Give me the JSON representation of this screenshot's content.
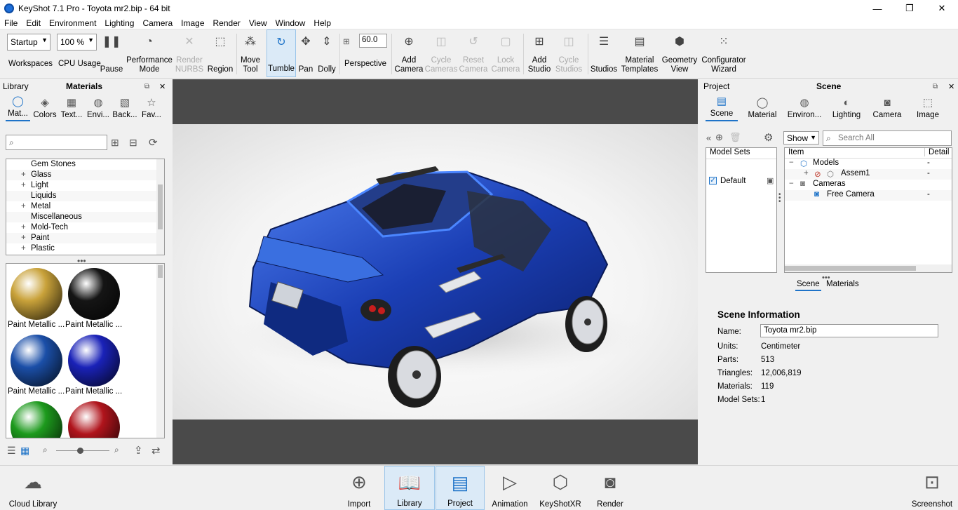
{
  "window": {
    "title": "KeyShot 7.1 Pro  - Toyota mr2.bip  - 64 bit",
    "minimize": "—",
    "maximize": "❐",
    "close": "✕"
  },
  "menu": [
    "File",
    "Edit",
    "Environment",
    "Lighting",
    "Camera",
    "Image",
    "Render",
    "View",
    "Window",
    "Help"
  ],
  "toolbar": {
    "workspace_value": "Startup",
    "workspaces_label": "Workspaces",
    "cpu_value": "100 %",
    "cpu_label": "CPU Usage",
    "pause": "Pause",
    "performance_mode": "Performance\nMode",
    "render_nurbs": "Render\nNURBS",
    "region": "Region",
    "move_tool": "Move\nTool",
    "tumble": "Tumble",
    "pan": "Pan",
    "dolly": "Dolly",
    "fov_value": "60.0",
    "perspective": "Perspective",
    "add_camera": "Add\nCamera",
    "cycle_cameras": "Cycle\nCameras",
    "reset_camera": "Reset\nCamera",
    "lock_camera": "Lock\nCamera",
    "add_studio": "Add\nStudio",
    "cycle_studios": "Cycle\nStudios",
    "studios": "Studios",
    "material_templates": "Material\nTemplates",
    "geometry_view": "Geometry\nView",
    "configurator_wizard": "Configurator\nWizard"
  },
  "library": {
    "panel_label": "Library",
    "panel_title": "Materials",
    "tabs": [
      "Mat...",
      "Colors",
      "Text...",
      "Envi...",
      "Back...",
      "Fav..."
    ],
    "tree": [
      "Gem Stones",
      "Glass",
      "Light",
      "Liquids",
      "Metal",
      "Miscellaneous",
      "Mold-Tech",
      "Paint",
      "Plastic"
    ],
    "thumbs": [
      {
        "caption": "Paint Metallic ...",
        "color": "#c9a23a"
      },
      {
        "caption": "Paint Metallic ...",
        "color": "#151515"
      },
      {
        "caption": "Paint Metallic ...",
        "color": "#1b4fa8"
      },
      {
        "caption": "Paint Metallic ...",
        "color": "#1a22b8"
      },
      {
        "caption": "",
        "color": "#1d9a1d"
      },
      {
        "caption": "",
        "color": "#b0141c"
      }
    ]
  },
  "project": {
    "panel_label": "Project",
    "panel_title": "Scene",
    "tabs": [
      "Scene",
      "Material",
      "Environ...",
      "Lighting",
      "Camera",
      "Image"
    ],
    "show_value": "Show",
    "search_placeholder": "Search All",
    "model_sets_header": "Model Sets",
    "model_set_default": "Default",
    "item_header": "Item",
    "detail_header": "Detail",
    "tree": [
      {
        "label": "Models",
        "detail": "-"
      },
      {
        "label": "Assem1",
        "detail": "-"
      },
      {
        "label": "Cameras",
        "detail": ""
      },
      {
        "label": "Free Camera",
        "detail": "-"
      }
    ],
    "subtabs": [
      "Scene",
      "Materials"
    ],
    "info_title": "Scene Information",
    "info": {
      "name_label": "Name:",
      "name_value": "Toyota mr2.bip",
      "units_label": "Units:",
      "units_value": "Centimeter",
      "parts_label": "Parts:",
      "parts_value": "513",
      "triangles_label": "Triangles:",
      "triangles_value": "12,006,819",
      "materials_label": "Materials:",
      "materials_value": "119",
      "modelsets_label": "Model Sets:",
      "modelsets_value": "1"
    }
  },
  "bottom": {
    "cloud_library": "Cloud Library",
    "import": "Import",
    "library": "Library",
    "project": "Project",
    "animation": "Animation",
    "keyshotxr": "KeyShotXR",
    "render": "Render",
    "screenshot": "Screenshot"
  }
}
